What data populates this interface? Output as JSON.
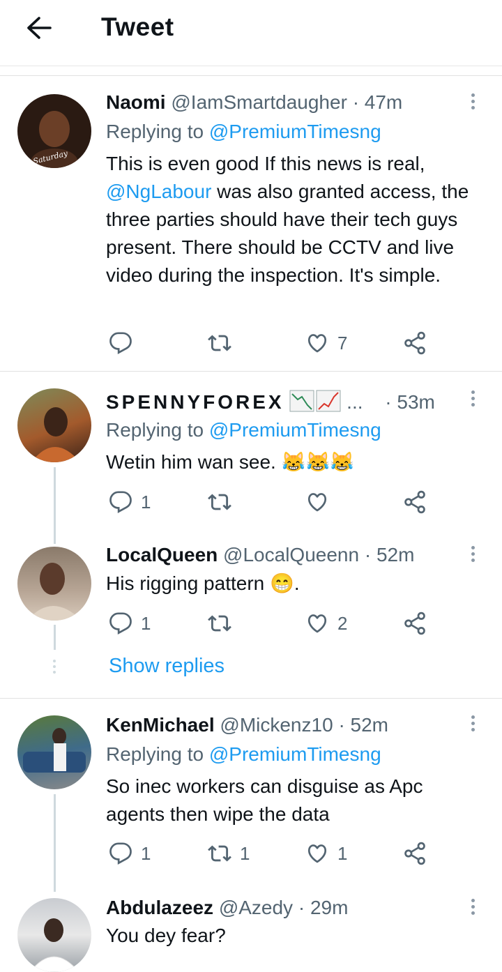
{
  "header": {
    "title": "Tweet"
  },
  "colors": {
    "accent": "#1d9bf0",
    "muted": "#536471",
    "text": "#0f1419"
  },
  "tweets": [
    {
      "name": "Naomi",
      "handle": "@IamSmartdaugher",
      "time": "· 47m",
      "replying_prefix": "Replying to",
      "replying_to": "@PremiumTimesng",
      "text_a": "This is even good If this news is real,",
      "mention": "@NgLabour",
      "text_b": " was also granted access, the three parties should have their tech guys present. There should be CCTV and live video during the inspection.  It's simple.",
      "avatar_caption": "Saturday",
      "reply_count": "",
      "retweet_count": "",
      "like_count": "7"
    },
    {
      "name": "SPENNYFOREX",
      "name_suffix": "...",
      "time": "· 53m",
      "replying_prefix": "Replying to",
      "replying_to": "@PremiumTimesng",
      "text": "Wetin him wan see.  😹😹😹",
      "reply_count": "1",
      "retweet_count": "",
      "like_count": ""
    },
    {
      "name": "LocalQueen",
      "handle": "@LocalQueenn",
      "time": "· 52m",
      "text": "His rigging pattern 😁.",
      "reply_count": "1",
      "retweet_count": "",
      "like_count": "2",
      "show_replies": "Show replies"
    },
    {
      "name": "KenMichael",
      "handle": "@Mickenz10",
      "time": "· 52m",
      "replying_prefix": "Replying to",
      "replying_to": "@PremiumTimesng",
      "text": "So inec workers can disguise as Apc agents then wipe the data",
      "reply_count": "1",
      "retweet_count": "1",
      "like_count": "1"
    },
    {
      "name": "Abdulazeez",
      "handle": "@Azedy",
      "time": "· 29m",
      "text": "You dey fear?"
    }
  ]
}
